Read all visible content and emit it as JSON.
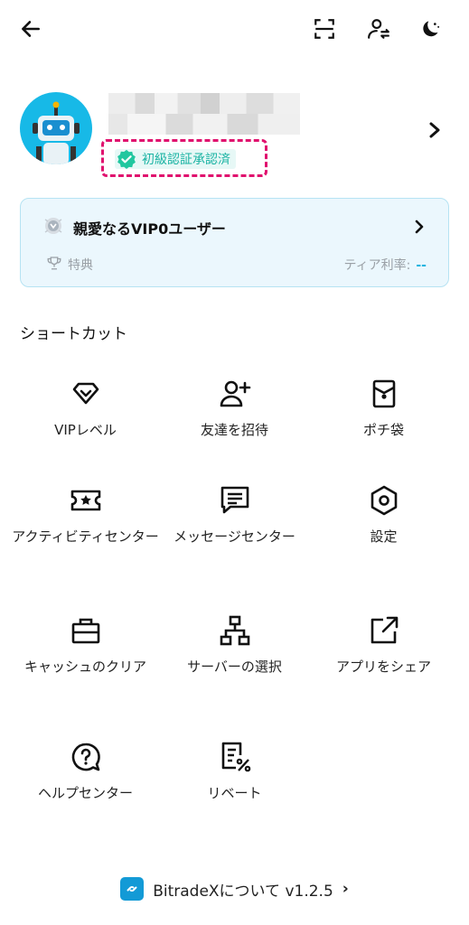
{
  "topbar": {
    "back_icon": "arrow-left-icon",
    "scan_icon": "scan-icon",
    "switch_account_icon": "user-switch-icon",
    "theme_icon": "moon-icon"
  },
  "profile": {
    "verification_label": "初級認証承認済",
    "chevron_icon": "chevron-right-icon"
  },
  "vip": {
    "title": "親愛なるVIP0ユーザー",
    "benefit_label": "特典",
    "rate_label": "ティア利率:",
    "rate_value": "--"
  },
  "shortcuts": {
    "title": "ショートカット",
    "items": [
      {
        "label": "VIPレベル",
        "icon": "diamond-icon"
      },
      {
        "label": "友達を招待",
        "icon": "add-user-icon"
      },
      {
        "label": "ポチ袋",
        "icon": "red-envelope-icon"
      },
      {
        "label": "アクティビティセンター",
        "icon": "ticket-star-icon"
      },
      {
        "label": "メッセージセンター",
        "icon": "message-icon"
      },
      {
        "label": "設定",
        "icon": "settings-icon"
      },
      {
        "label": "キャッシュのクリア",
        "icon": "toolbox-icon"
      },
      {
        "label": "サーバーの選択",
        "icon": "network-icon"
      },
      {
        "label": "アプリをシェア",
        "icon": "share-icon"
      },
      {
        "label": "ヘルプセンター",
        "icon": "help-icon"
      },
      {
        "label": "リベート",
        "icon": "rebate-icon"
      }
    ]
  },
  "about": {
    "label": "BitradeXについて v1.2.5",
    "chevron": "›"
  }
}
